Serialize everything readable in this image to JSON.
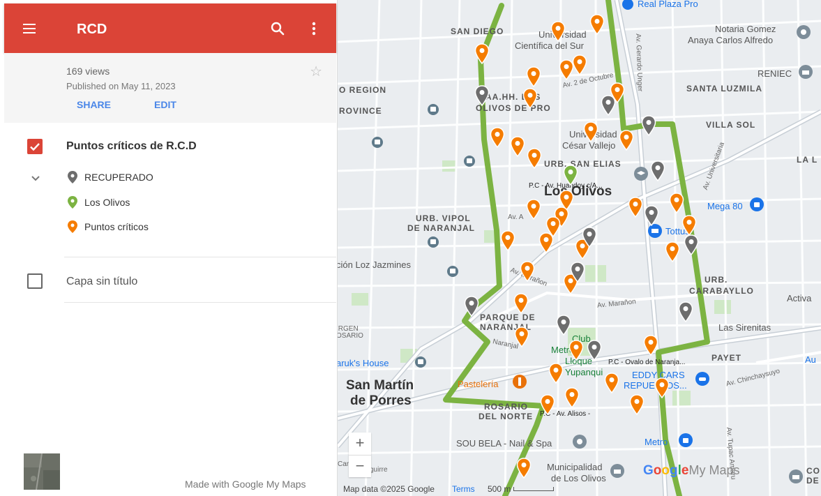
{
  "app": {
    "title": "RCD",
    "menu_icon": "hamburger-icon",
    "search_icon": "search-icon",
    "more_icon": "more-vert-icon",
    "brand_color": "#db4437"
  },
  "meta": {
    "views": "169 views",
    "published": "Published on May 11, 2023",
    "share_label": "SHARE",
    "edit_label": "EDIT",
    "star_icon": "star-outline-icon"
  },
  "layers": [
    {
      "title": "Puntos críticos de R.C.D",
      "checked": true,
      "legend": [
        {
          "label": "RECUPERADO",
          "color": "#6d6d6d"
        },
        {
          "label": "Los Olivos",
          "color": "#7cb342"
        },
        {
          "label": "Puntos críticos",
          "color": "#f57c00"
        }
      ]
    },
    {
      "title": "Capa sin título",
      "checked": false
    }
  ],
  "footer": {
    "made_with": "Made with Google My Maps"
  },
  "map": {
    "labels": {
      "san_diego": "SAN DIEGO",
      "universidad": "Universidad",
      "cientifica": "Científica del Sur",
      "real_plaza": "Real Plaza Pro",
      "notaria_1": "Notaria Gomez",
      "notaria_2": "Anaya Carlos Alfredo",
      "reniec": "RENIEC",
      "santa_luzmila": "SANTA LUZMILA",
      "o_region": "O REGION",
      "rovince": "ROVINCE",
      "aa_hh": "AA.HH. LOS",
      "olivos_pro": "OLIVOS DE PRO",
      "villa_sol": "VILLA SOL",
      "ucv_1": "Universidad",
      "ucv_2": "César Vallejo",
      "la": "LA L",
      "urb_elias": "URB. SAN ELIAS",
      "los_olivos": "Los Olivos",
      "pc_huandoy": "P.C - Av. Huandoy c/A...",
      "mega": "Mega 80",
      "urb_vipol_1": "URB. VIPOL",
      "urb_vipol_2": "DE NARANJAL",
      "tottus": "Tottus",
      "jazmines": "ción Loz Jazmines",
      "urb_carabayllo_1": "URB.",
      "urb_carabayllo_2": "CARABAYLLO",
      "activa": "Activa",
      "parque_1": "PARQUE DE",
      "parque_2": "NARANJAL",
      "irgen_1": "IRGEN",
      "irgen_2": "OSARIO",
      "sirenitas": "Las Sirenitas",
      "club_1": "Club",
      "club_2": "Metro",
      "lloque_1": "Lloque",
      "lloque_2": "Yupanqui",
      "pc_ovalo": "P.C - Ovalo de Naranja...",
      "payet": "PAYET",
      "au": "Au",
      "eddy_1": "EDDY CARS",
      "eddy_2": "REPUESTOS...",
      "aruk": "aruk's House",
      "san_martin_1": "San Martín",
      "san_martin_2": "de Porres",
      "pasteleria": "Pastelería",
      "rosario_1": "ROSARIO",
      "rosario_2": "DEL NORTE",
      "pc_alisos": "P.C - Av. Alisos -",
      "sou_bela": "SOU BELA - Nail & Spa",
      "metro": "Metro",
      "muni_1": "Municipalidad",
      "muni_2": "de Los Olivos",
      "co_1": "CO",
      "co_2": "DE",
      "car": "Car",
      "guirre": "guirre",
      "av_gerardo": "Av. Gerardo Unger",
      "av_2oct": "Av. 2 de Octubre",
      "av_universitaria": "Av. Universitaria",
      "av_maranon_1": "Av. Marañon",
      "av_maranon_2": "Av. Marañon",
      "av_naranjal": "Naranjal",
      "av_chinchaysuyo": "Av. Chinchaysuyo",
      "av_tupac": "Av. Tupac Amaru",
      "av_a": "Av. A"
    },
    "zoom_in": "+",
    "zoom_out": "−",
    "attribution": "Map data ©2025 Google",
    "terms": "Terms",
    "scale": "500 m",
    "logo_google": "Google",
    "logo_mymaps": "My Maps",
    "route_color": "#7cb342",
    "marker_colors": {
      "gray": "#6d6d6d",
      "green": "#7cb342",
      "orange": "#f57c00"
    }
  }
}
